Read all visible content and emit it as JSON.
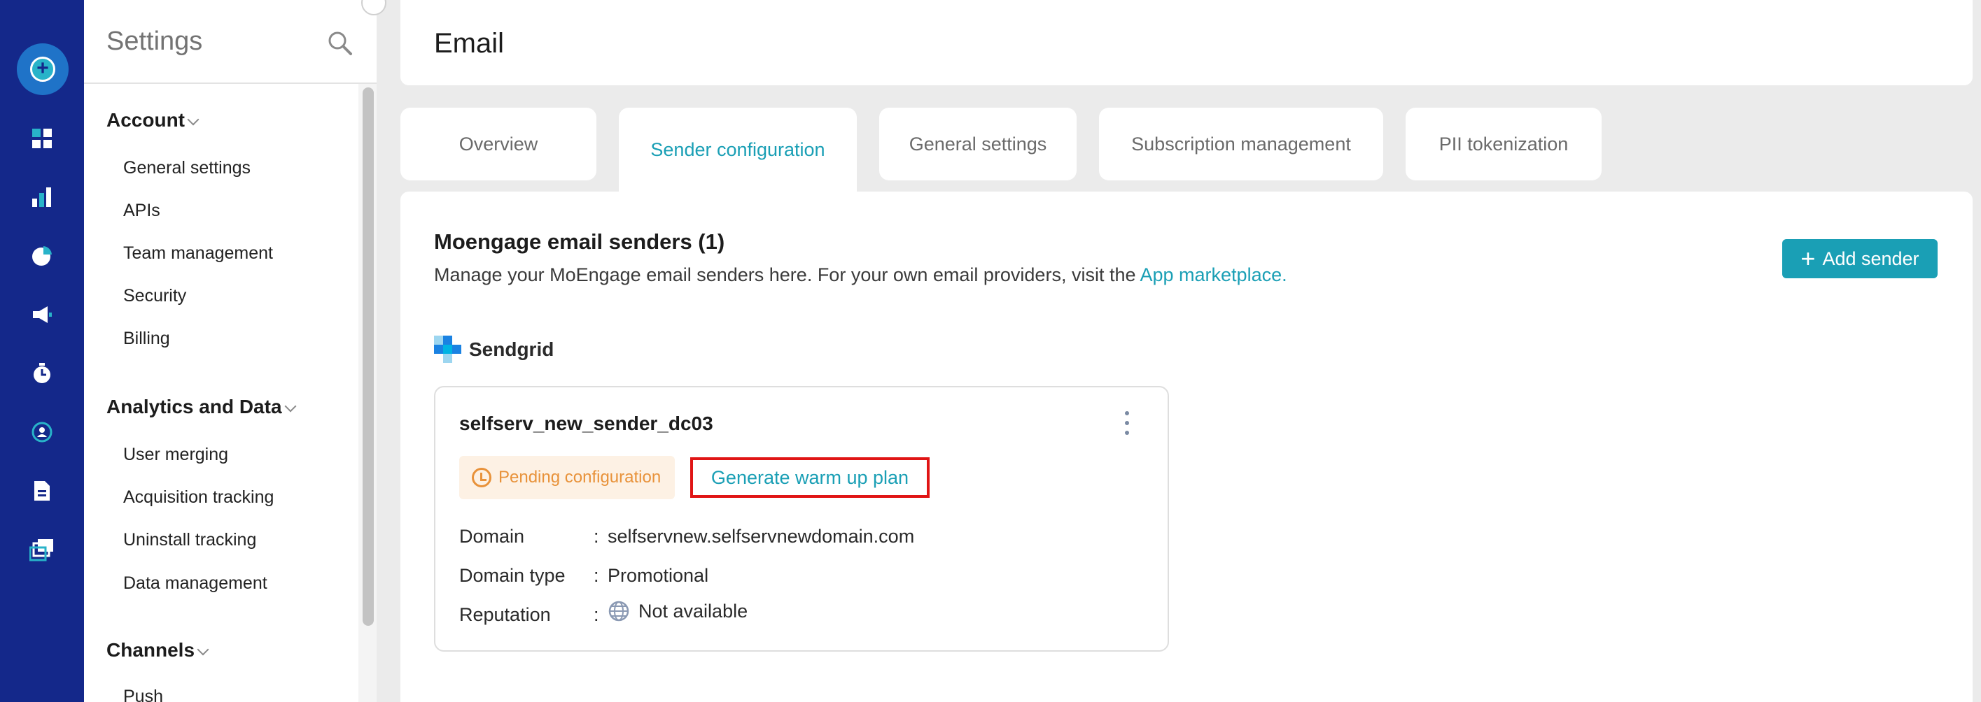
{
  "rail": {
    "icons": [
      "add-icon",
      "dashboard-icon",
      "analytics-icon",
      "segment-icon",
      "campaign-icon",
      "timer-icon",
      "audience-icon",
      "document-icon",
      "content-icon"
    ]
  },
  "sidebar": {
    "title": "Settings",
    "groups": [
      {
        "label": "Account",
        "items": [
          "General settings",
          "APIs",
          "Team management",
          "Security",
          "Billing"
        ]
      },
      {
        "label": "Analytics and Data",
        "items": [
          "User merging",
          "Acquisition tracking",
          "Uninstall tracking",
          "Data management"
        ]
      },
      {
        "label": "Channels",
        "items": [
          "Push"
        ]
      }
    ]
  },
  "page": {
    "title": "Email",
    "tabs": [
      {
        "label": "Overview",
        "active": false
      },
      {
        "label": "Sender configuration",
        "active": true
      },
      {
        "label": "General settings",
        "active": false
      },
      {
        "label": "Subscription management",
        "active": false
      },
      {
        "label": "PII tokenization",
        "active": false
      }
    ]
  },
  "senders": {
    "title": "Moengage email senders (1)",
    "description": "Manage your MoEngage email senders here. For your own email providers, visit the",
    "link_text": "App marketplace.",
    "add_button": "Add sender",
    "provider": "Sendgrid",
    "card": {
      "name": "selfserv_new_sender_dc03",
      "status": "Pending configuration",
      "action": "Generate warm up plan",
      "rows": [
        {
          "label": "Domain",
          "value": "selfservnew.selfservnewdomain.com"
        },
        {
          "label": "Domain type",
          "value": "Promotional"
        },
        {
          "label": "Reputation",
          "value": "Not available"
        }
      ],
      "colon": ":"
    }
  },
  "colors": {
    "rail": "#14288a",
    "accent": "#1a9fb5",
    "pending": "#e8923a",
    "highlight": "#e01515"
  }
}
